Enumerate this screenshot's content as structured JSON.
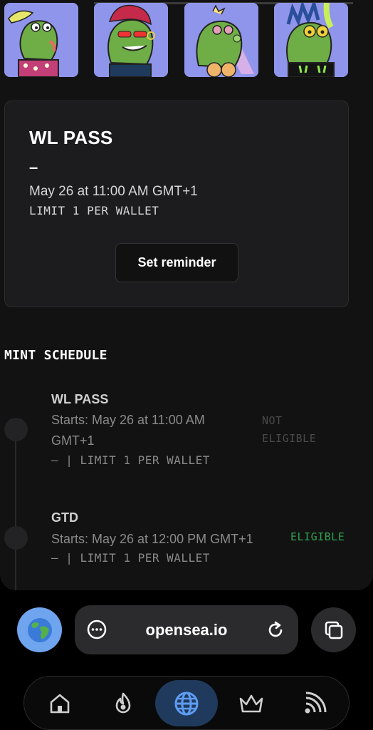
{
  "mint_card": {
    "title": "WL PASS",
    "price": "–",
    "date": "May 26 at 11:00 AM GMT+1",
    "limit": "LIMIT 1 PER WALLET",
    "reminder_label": "Set reminder"
  },
  "schedule": {
    "title": "MINT SCHEDULE",
    "phases": [
      {
        "name": "WL PASS",
        "starts_line1": "Starts: May 26 at 11:00 AM",
        "starts_line2": "GMT+1",
        "limit": "– | LIMIT 1 PER WALLET",
        "status_line1": "NOT",
        "status_line2": "ELIGIBLE"
      },
      {
        "name": "GTD",
        "starts_line1": "Starts: May 26 at 12:00 PM GMT+1",
        "limit": "– | LIMIT 1 PER WALLET",
        "status": "ELIGIBLE"
      }
    ]
  },
  "browser": {
    "url": "opensea.io",
    "nav": [
      "home-icon",
      "flame-icon",
      "globe-icon",
      "crown-icon",
      "feed-icon"
    ],
    "active_nav": "globe-icon"
  },
  "colors": {
    "eligible": "#2fa24f",
    "not_eligible": "#4a4a4a",
    "thumb_bg": "#8f95ea",
    "accent": "#6fa4ee"
  }
}
